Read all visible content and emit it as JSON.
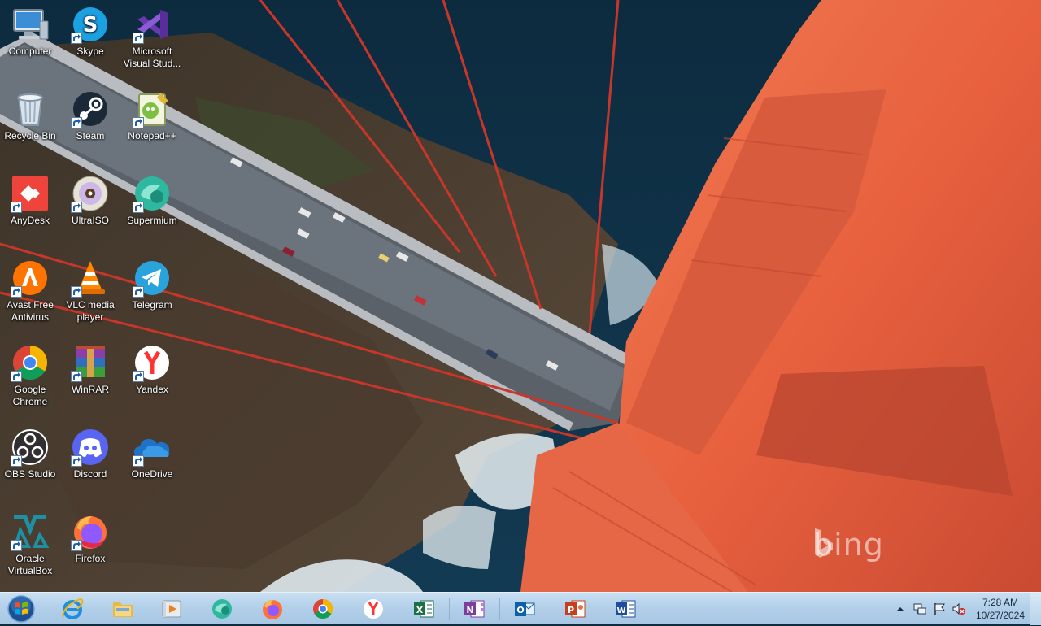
{
  "desktop": {
    "icons": [
      {
        "label": "Computer",
        "icon": "computer-icon",
        "shortcut": false
      },
      {
        "label": "Skype",
        "icon": "skype-icon",
        "shortcut": true
      },
      {
        "label": "Microsoft Visual Stud...",
        "icon": "visual-studio-icon",
        "shortcut": true
      },
      {
        "label": "Recycle Bin",
        "icon": "recycle-bin-icon",
        "shortcut": false
      },
      {
        "label": "Steam",
        "icon": "steam-icon",
        "shortcut": true
      },
      {
        "label": "Notepad++",
        "icon": "notepad-plus-plus-icon",
        "shortcut": true
      },
      {
        "label": "AnyDesk",
        "icon": "anydesk-icon",
        "shortcut": true
      },
      {
        "label": "UltraISO",
        "icon": "ultraiso-icon",
        "shortcut": true
      },
      {
        "label": "Supermium",
        "icon": "supermium-icon",
        "shortcut": true
      },
      {
        "label": "Avast Free Antivirus",
        "icon": "avast-icon",
        "shortcut": true
      },
      {
        "label": "VLC media player",
        "icon": "vlc-icon",
        "shortcut": true
      },
      {
        "label": "Telegram",
        "icon": "telegram-icon",
        "shortcut": true
      },
      {
        "label": "Google Chrome",
        "icon": "chrome-icon",
        "shortcut": true
      },
      {
        "label": "WinRAR",
        "icon": "winrar-icon",
        "shortcut": true
      },
      {
        "label": "Yandex",
        "icon": "yandex-icon",
        "shortcut": true
      },
      {
        "label": "OBS Studio",
        "icon": "obs-icon",
        "shortcut": true
      },
      {
        "label": "Discord",
        "icon": "discord-icon",
        "shortcut": true
      },
      {
        "label": "OneDrive",
        "icon": "onedrive-icon",
        "shortcut": true
      },
      {
        "label": "Oracle VirtualBox",
        "icon": "virtualbox-icon",
        "shortcut": true
      },
      {
        "label": "Firefox",
        "icon": "firefox-icon",
        "shortcut": true
      }
    ]
  },
  "wallpaper": {
    "watermark": "bing"
  },
  "taskbar": {
    "start_icon": "windows-start-orb-icon",
    "pinned": [
      {
        "icon": "internet-explorer-icon"
      },
      {
        "icon": "file-explorer-icon"
      },
      {
        "icon": "media-player-icon"
      },
      {
        "icon": "supermium-icon"
      },
      {
        "icon": "firefox-icon"
      },
      {
        "icon": "chrome-icon"
      },
      {
        "icon": "yandex-icon"
      },
      {
        "icon": "excel-icon"
      },
      {
        "icon": "onenote-icon"
      },
      {
        "icon": "outlook-icon"
      },
      {
        "icon": "powerpoint-icon"
      },
      {
        "icon": "word-icon"
      }
    ],
    "tray": {
      "icons": [
        "show-hidden-icons-chevron",
        "network-icon",
        "action-center-flag-icon",
        "volume-muted-icon"
      ],
      "time": "7:28 AM",
      "date": "10/27/2024"
    }
  }
}
